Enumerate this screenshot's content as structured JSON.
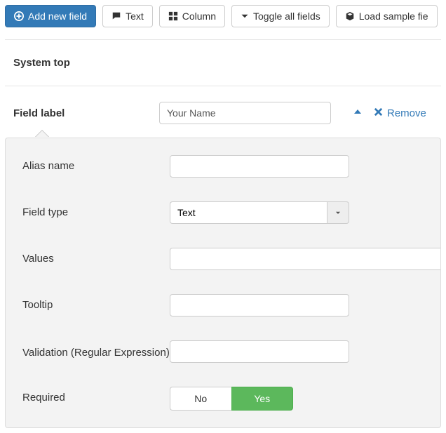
{
  "toolbar": {
    "add_new_field": "Add new field",
    "text": "Text",
    "column": "Column",
    "toggle_all": "Toggle all fields",
    "load_sample": "Load sample fie"
  },
  "section": {
    "title": "System top"
  },
  "field": {
    "label_title": "Field label",
    "label_value": "Your Name",
    "remove": "Remove"
  },
  "config": {
    "alias_name": {
      "label": "Alias name",
      "value": ""
    },
    "field_type": {
      "label": "Field type",
      "value": "Text"
    },
    "values": {
      "label": "Values",
      "value": ""
    },
    "tooltip": {
      "label": "Tooltip",
      "value": ""
    },
    "validation": {
      "label": "Validation (Regular Expression)",
      "value": ""
    },
    "required": {
      "label": "Required",
      "no": "No",
      "yes": "Yes",
      "selected": "yes"
    }
  }
}
